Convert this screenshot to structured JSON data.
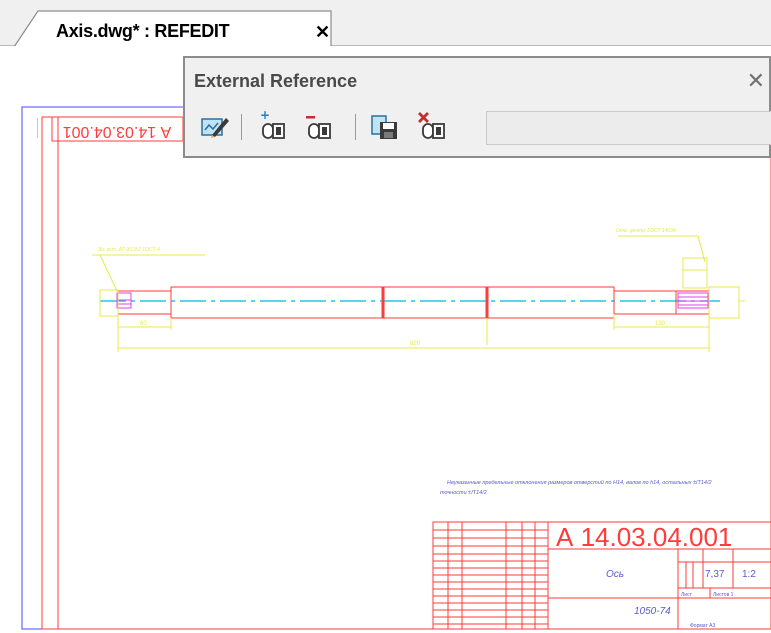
{
  "tab": {
    "title": "Axis.dwg* : REFEDIT",
    "close": "✕"
  },
  "toolbar": {
    "title": "External Reference",
    "close": "✕",
    "tools": [
      "edit-reference-icon",
      "add-to-workset-icon",
      "remove-from-workset-icon",
      "save-reference-edits-icon",
      "discard-reference-changes-icon"
    ]
  },
  "drawing": {
    "title_block_code": "А 14.03.04.001",
    "mirrored_code": "А 14.03.04.001",
    "part_name": "Ось",
    "material": "1050-74",
    "mass": "7,37",
    "scale": "1:2",
    "leader_left": "Зн. уст. АТ-9/1357 ГОСТ 4",
    "leader_right": "Отв. центр. ГОСТ 14034",
    "note": "Неуказанные предельные отклонения размеров отверстий по Н14, валов по h14, остальных ±IT14/2",
    "note_line2": "точности ±IT14/2",
    "dim_overall": "820",
    "dim_left": "60",
    "dim_right": "130",
    "label_sheet": "Лист",
    "label_sheets": "Листов 1",
    "label_format": "Формат А3",
    "colors": {
      "frame": "#ff3b3b",
      "dims": "#e8e84a",
      "centerline": "#1fc9e6",
      "hatch": "#e040e0",
      "viewport": "#4a4af0"
    }
  }
}
